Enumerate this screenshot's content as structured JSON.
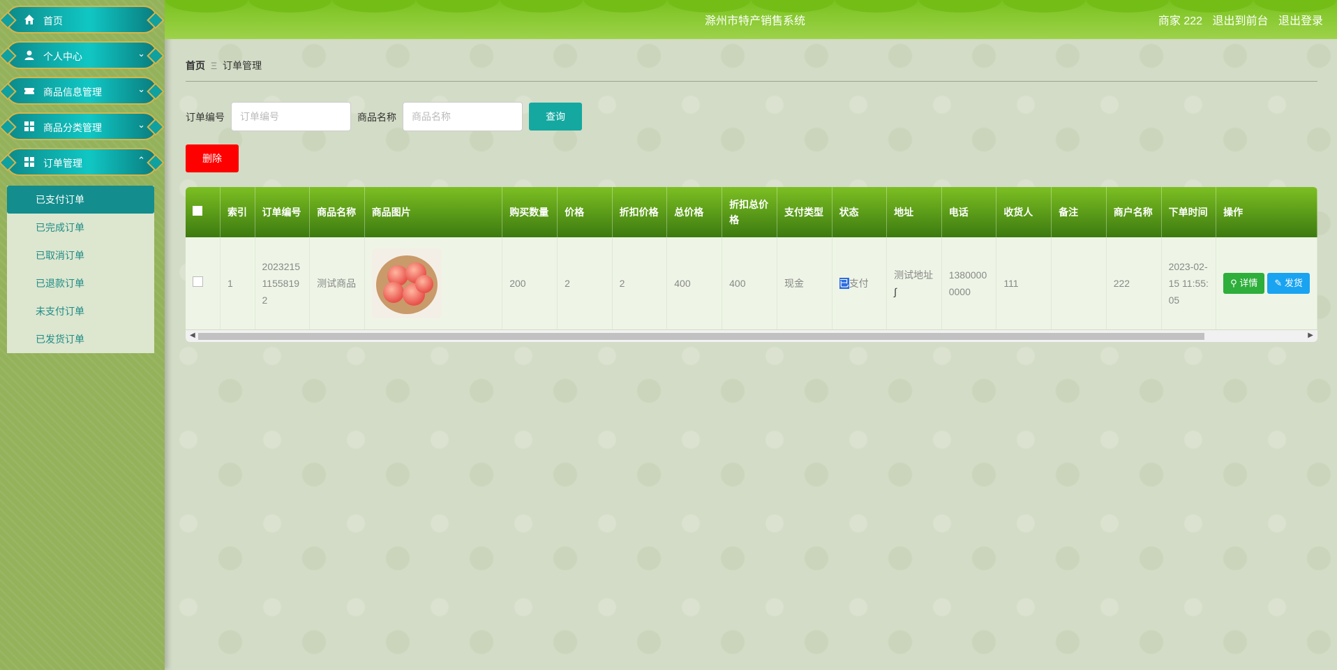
{
  "sidebar": {
    "menus": [
      {
        "label": "首页",
        "icon": "home-icon"
      },
      {
        "label": "个人中心",
        "icon": "user-icon"
      },
      {
        "label": "商品信息管理",
        "icon": "ticket-icon"
      },
      {
        "label": "商品分类管理",
        "icon": "grid-icon"
      },
      {
        "label": "订单管理",
        "icon": "grid-icon"
      }
    ],
    "submenu": [
      "已支付订单",
      "已完成订单",
      "已取消订单",
      "已退款订单",
      "未支付订单",
      "已发货订单"
    ]
  },
  "header": {
    "title": "滁州市特产销售系统",
    "user": "商家 222",
    "to_front": "退出到前台",
    "logout": "退出登录"
  },
  "breadcrumb": {
    "home": "首页",
    "sep": "Ξ",
    "current": "订单管理"
  },
  "search": {
    "order_no_label": "订单编号",
    "order_no_placeholder": "订单编号",
    "goods_name_label": "商品名称",
    "goods_name_placeholder": "商品名称",
    "query_button": "查询",
    "delete_button": "删除"
  },
  "table": {
    "columns": [
      "索引",
      "订单编号",
      "商品名称",
      "商品图片",
      "购买数量",
      "价格",
      "折扣价格",
      "总价格",
      "折扣总价格",
      "支付类型",
      "状态",
      "地址",
      "电话",
      "收货人",
      "备注",
      "商户名称",
      "下单时间",
      "操作"
    ],
    "rows": [
      {
        "index": "1",
        "order_no": "20232151155819 2",
        "goods_name": "测试商品",
        "quantity": "200",
        "price": "2",
        "discount_price": "2",
        "total": "400",
        "discount_total": "400",
        "pay_type": "现金",
        "status_sel": "已",
        "status_rest": "支付",
        "address": "测试地址",
        "phone": "13800000000",
        "receiver": "111",
        "note": "",
        "merchant": "222",
        "order_time": "2023-02-15 11:55:05",
        "detail_btn": "详情",
        "ship_btn": "发货"
      }
    ]
  }
}
